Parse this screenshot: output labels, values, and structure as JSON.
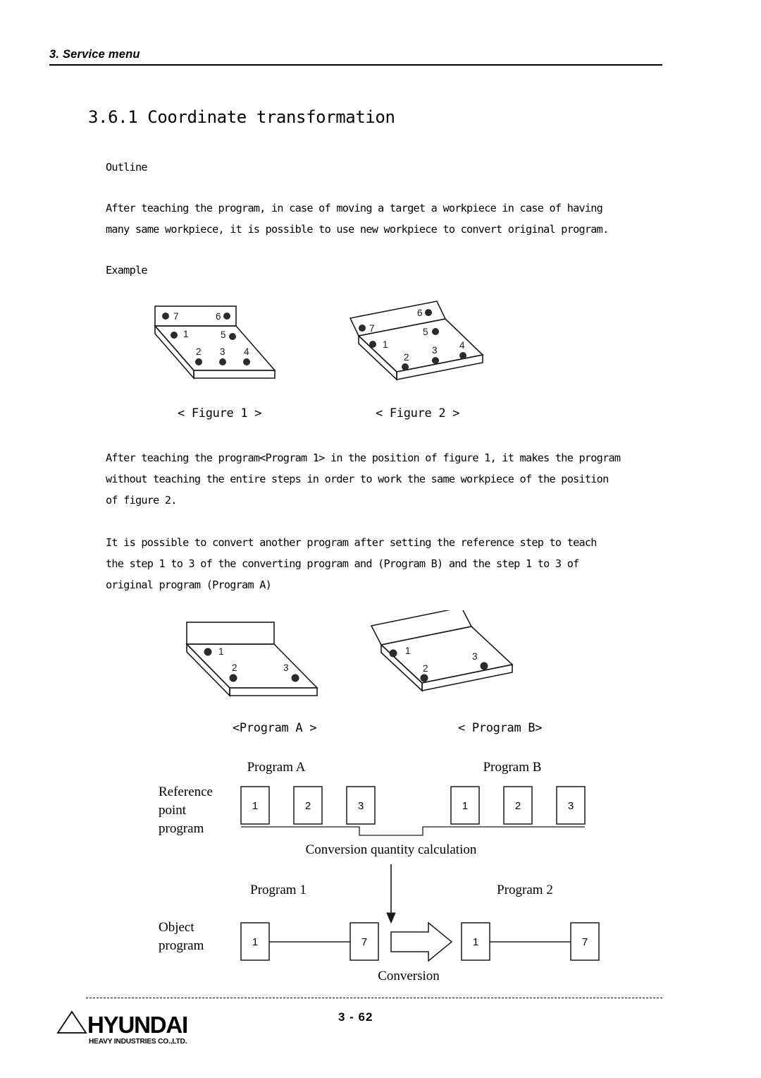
{
  "header": {
    "title": "3. Service menu"
  },
  "section": {
    "heading": "3.6.1 Coordinate transformation",
    "outline_label": "Outline",
    "outline_paragraph": [
      "After teaching the program, in case of moving a target a workpiece in case of having",
      "many same workpiece, it is possible to use new workpiece to convert original program."
    ],
    "example_label": "Example",
    "paragraph_after": [
      " After teaching the program<Program 1> in the position of figure 1, it makes the program",
      "without teaching the entire steps in order to work the same workpiece of the position",
      "of figure 2."
    ],
    "paragraph_convert": [
      "It is possible to convert another program after setting the reference step to teach",
      "the step 1 to 3 of the converting program and (Program B) and the step 1 to 3 of",
      "original program (Program A)"
    ]
  },
  "figures": {
    "figure1": {
      "caption": "< Figure 1 >",
      "point_labels": [
        "7",
        "6",
        "1",
        "5",
        "2",
        "3",
        "4"
      ]
    },
    "figure2": {
      "caption": "< Figure 2 >",
      "point_labels": [
        "7",
        "6",
        "1",
        "5",
        "2",
        "3",
        "4"
      ]
    },
    "program_a": {
      "caption": "<Program A >",
      "point_labels": [
        "1",
        "2",
        "3"
      ]
    },
    "program_b": {
      "caption": "< Program B>",
      "point_labels": [
        "1",
        "2",
        "3"
      ]
    }
  },
  "flow": {
    "reference_row_label": [
      "Reference",
      "point",
      "program"
    ],
    "object_row_label": [
      "Object",
      "program"
    ],
    "program_a_title": "Program A",
    "program_b_title": "Program B",
    "program_1_title": "Program 1",
    "program_2_title": "Program 2",
    "conversion_quantity_label": "Conversion quantity calculation",
    "conversion_label": "Conversion",
    "reference_boxes_a": [
      "1",
      "2",
      "3"
    ],
    "reference_boxes_b": [
      "1",
      "2",
      "3"
    ],
    "object_boxes_1": [
      "1",
      "7"
    ],
    "object_boxes_2": [
      "1",
      "7"
    ]
  },
  "footer": {
    "logo_text": "HYUNDAI",
    "logo_subtext": "HEAVY INDUSTRIES CO.,LTD.",
    "page_number": "3 -  62"
  },
  "colors": {
    "ink": "#000000",
    "dot": "#2b2b2b",
    "rule": "#000000"
  }
}
